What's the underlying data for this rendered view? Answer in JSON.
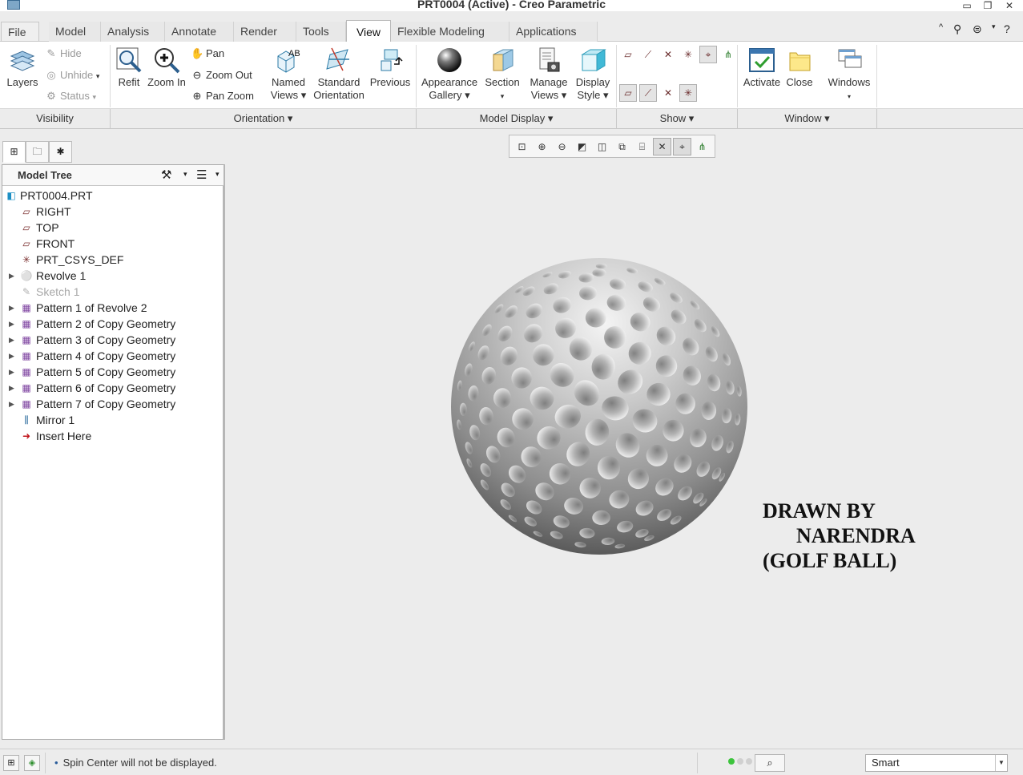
{
  "window": {
    "title": "PRT0004 (Active) - Creo Parametric",
    "minimize_glyph": "▭",
    "restore_glyph": "❐",
    "close_glyph": "✕"
  },
  "tabs": {
    "file": "File ▾",
    "items": [
      "Model",
      "Analysis",
      "Annotate",
      "Render",
      "Tools",
      "View",
      "Flexible Modeling",
      "Applications"
    ],
    "active": "View"
  },
  "ribbon": {
    "visibility": {
      "layers": "Layers",
      "hide": "Hide",
      "unhide": "Unhide",
      "status": "Status",
      "label": "Visibility"
    },
    "orientation": {
      "refit": "Refit",
      "zoom_in": "Zoom In",
      "pan": "Pan",
      "zoom_out": "Zoom Out",
      "pan_zoom": "Pan Zoom",
      "named_views_1": "Named",
      "named_views_2": "Views ▾",
      "standard_orientation_1": "Standard",
      "standard_orientation_2": "Orientation",
      "previous": "Previous",
      "label": "Orientation ▾"
    },
    "model_display": {
      "appearance_gallery_1": "Appearance",
      "appearance_gallery_2": "Gallery ▾",
      "section": "Section",
      "manage_views_1": "Manage",
      "manage_views_2": "Views ▾",
      "display_style_1": "Display",
      "display_style_2": "Style ▾",
      "label": "Model Display ▾"
    },
    "show": {
      "label": "Show ▾"
    },
    "window": {
      "activate": "Activate",
      "close": "Close",
      "windows": "Windows",
      "label": "Window ▾"
    }
  },
  "model_tree": {
    "header": "Model Tree",
    "root": "PRT0004.PRT",
    "items": [
      {
        "label": "RIGHT",
        "icon": "datum-plane-icon",
        "expandable": false,
        "disabled": false
      },
      {
        "label": "TOP",
        "icon": "datum-plane-icon",
        "expandable": false,
        "disabled": false
      },
      {
        "label": "FRONT",
        "icon": "datum-plane-icon",
        "expandable": false,
        "disabled": false
      },
      {
        "label": "PRT_CSYS_DEF",
        "icon": "csys-icon",
        "expandable": false,
        "disabled": false
      },
      {
        "label": "Revolve 1",
        "icon": "revolve-icon",
        "expandable": true,
        "disabled": false
      },
      {
        "label": "Sketch 1",
        "icon": "sketch-icon",
        "expandable": false,
        "disabled": true
      },
      {
        "label": "Pattern 1 of Revolve 2",
        "icon": "pattern-icon",
        "expandable": true,
        "disabled": false
      },
      {
        "label": "Pattern 2 of Copy Geometry",
        "icon": "pattern-icon",
        "expandable": true,
        "disabled": false
      },
      {
        "label": "Pattern 3 of Copy Geometry",
        "icon": "pattern-icon",
        "expandable": true,
        "disabled": false
      },
      {
        "label": "Pattern 4 of Copy Geometry",
        "icon": "pattern-icon",
        "expandable": true,
        "disabled": false
      },
      {
        "label": "Pattern 5 of Copy Geometry",
        "icon": "pattern-icon",
        "expandable": true,
        "disabled": false
      },
      {
        "label": "Pattern 6 of Copy Geometry",
        "icon": "pattern-icon",
        "expandable": true,
        "disabled": false
      },
      {
        "label": "Pattern 7 of Copy Geometry",
        "icon": "pattern-icon",
        "expandable": true,
        "disabled": false
      },
      {
        "label": "Mirror 1",
        "icon": "mirror-icon",
        "expandable": false,
        "disabled": false
      },
      {
        "label": "Insert Here",
        "icon": "insert-arrow-icon",
        "expandable": false,
        "disabled": false
      }
    ]
  },
  "graphics": {
    "note_line1": "DRAWN BY",
    "note_line2": "NARENDRA",
    "note_line3": "(GOLF BALL)"
  },
  "status": {
    "message": "Spin Center will not be displayed.",
    "filter": "Smart"
  }
}
